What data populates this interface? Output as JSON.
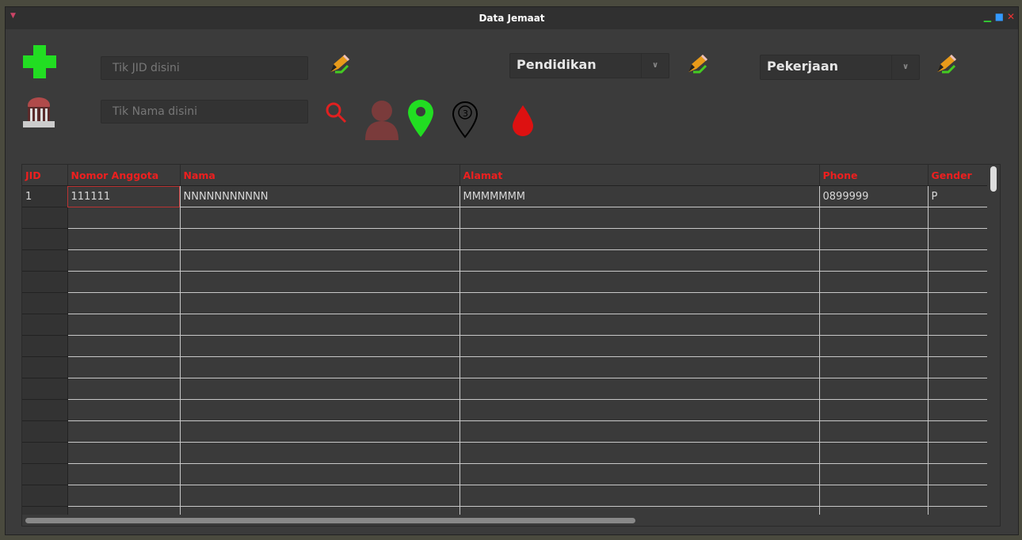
{
  "window": {
    "title": "Data Jemaat"
  },
  "toolbar": {
    "jid_placeholder": "Tik JID disini",
    "nama_placeholder": "Tik Nama disini",
    "pendidikan_selected": "Pendidikan",
    "pekerjaan_selected": "Pekerjaan"
  },
  "table": {
    "columns": [
      "JID",
      "Nomor Anggota",
      "Nama",
      "Alamat",
      "Phone",
      "Gender"
    ],
    "rows": [
      [
        "1",
        "111111",
        "NNNNNNNNNNN",
        "MMMMMMM",
        "0899999",
        "P"
      ]
    ]
  },
  "colors": {
    "accent_red": "#ee1f1f",
    "add_green": "#22dd22",
    "location_green": "#22dd22",
    "person_maroon": "#7a3b3b",
    "blood_red": "#dd1111"
  }
}
